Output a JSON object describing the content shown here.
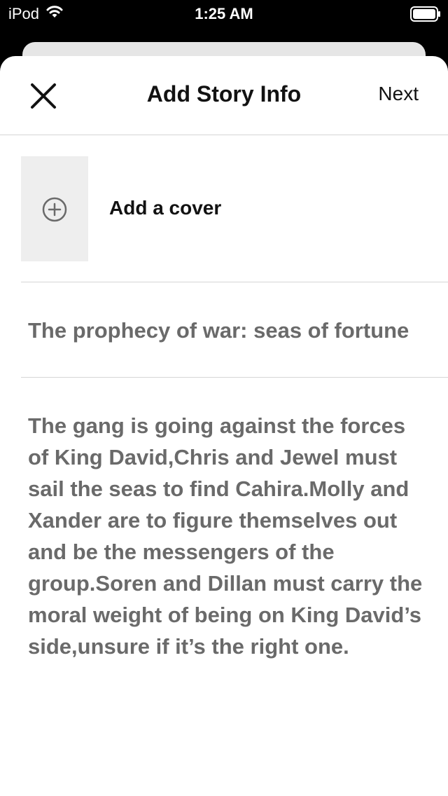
{
  "status_bar": {
    "device": "iPod",
    "time": "1:25 AM",
    "icons": [
      "wifi-icon",
      "battery-icon"
    ]
  },
  "nav": {
    "title": "Add Story Info",
    "next_label": "Next",
    "close_icon": "close-icon"
  },
  "cover": {
    "label": "Add a cover",
    "icon": "plus-circle-icon"
  },
  "story": {
    "title": "The prophecy of war: seas of fortune",
    "description": "The gang is going against the forces of King David,Chris and Jewel must sail the seas to find Cahira.Molly and Xander are to figure themselves out and be the messengers of the group.Soren and Dillan must carry the moral weight of being on King David’s side,unsure if it’s the right one."
  },
  "colors": {
    "status_bar_bg": "#000000",
    "sheet_bg": "#ffffff",
    "text_primary": "#121212",
    "text_field": "#6a6a6a",
    "divider": "#d6d6d6",
    "cover_placeholder": "#eeeeee"
  }
}
